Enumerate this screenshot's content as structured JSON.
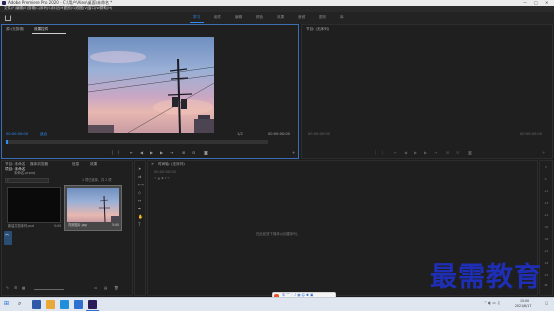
{
  "window": {
    "title": "Adobe Premiere Pro 2020 - C:\\用户\\Alex\\桌面\\未命名 *",
    "controls": [
      "—",
      "□",
      "✕"
    ]
  },
  "menu": [
    "文件(F)",
    "编辑(E)",
    "剪辑(C)",
    "序列(S)",
    "标记(M)",
    "图形(G)",
    "视图(V)",
    "窗口(W)",
    "帮助(H)"
  ],
  "workspaces": [
    "学习",
    "组件",
    "编辑",
    "颜色",
    "效果",
    "音频",
    "图形",
    "库"
  ],
  "source_panel": {
    "tab1": "源:(无剪辑)",
    "tab2": "效果控件",
    "clip_tab": "音频剪辑混合器",
    "timecode_left": "00:00:00:00",
    "fit": "适合",
    "ratio": "1/2",
    "timecode_right": "00:00:00:00"
  },
  "program_panel": {
    "tab": "节目: (无序列)",
    "timecode_left": "00:00:00:00",
    "timecode_right": "00:00:00:00"
  },
  "project_panel": {
    "tabs": [
      "节目: 未命名",
      "媒体浏览器",
      "项目: 未命名",
      "信息",
      "效果"
    ],
    "project_name": "未命名.prproj",
    "count": "1 项已选择，共 2 项",
    "items": [
      {
        "name": "新建文档序列.psd",
        "duration": "5:00"
      },
      {
        "name": "背景图片.jpg",
        "duration": "5:00"
      }
    ]
  },
  "timeline": {
    "tab": "时间轴: (无序列)",
    "timecode": "00:00:00:00",
    "empty_message": "在此处放下媒体以创建序列。"
  },
  "audio_meter_labels": [
    "0",
    "-6",
    "-12",
    "-18",
    "-24",
    "-30",
    "-36",
    "-42",
    "-48",
    "-54",
    "dB"
  ],
  "taskbar": {
    "time": "15:00",
    "date": "2021/6/17"
  },
  "watermark": "最需教育"
}
